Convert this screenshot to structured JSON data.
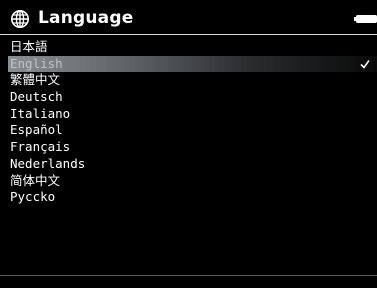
{
  "header": {
    "title": "Language",
    "icon": "globe-icon",
    "status_icon": "battery-icon"
  },
  "languages": [
    {
      "label": "日本語",
      "selected": false
    },
    {
      "label": "English",
      "selected": true
    },
    {
      "label": "繁體中文",
      "selected": false
    },
    {
      "label": "Deutsch",
      "selected": false
    },
    {
      "label": "Italiano",
      "selected": false
    },
    {
      "label": "Español",
      "selected": false
    },
    {
      "label": "Français",
      "selected": false
    },
    {
      "label": "Nederlands",
      "selected": false
    },
    {
      "label": "简体中文",
      "selected": false
    },
    {
      "label": "Pycckо",
      "selected": false
    }
  ],
  "colors": {
    "background": "#000000",
    "text": "#ffffff",
    "selection_start": "#8a8f93",
    "selection_end": "#0a0a0a"
  }
}
